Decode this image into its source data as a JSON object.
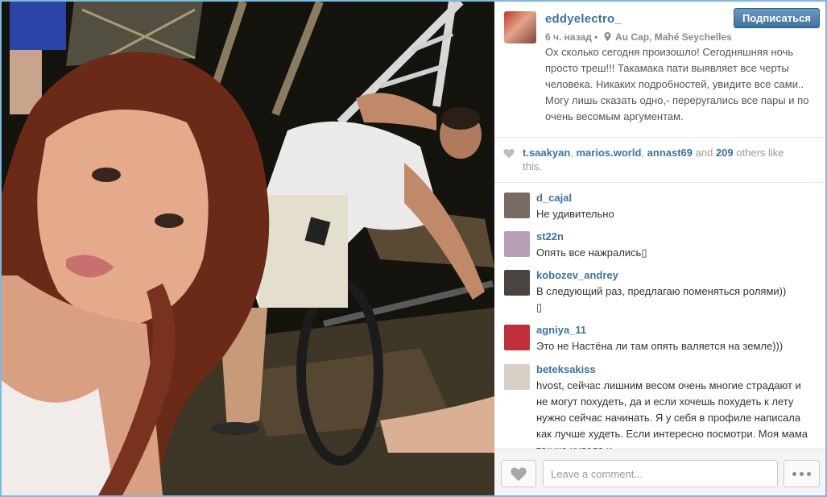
{
  "post": {
    "username": "eddyelectro_",
    "follow_label": "Подписаться",
    "time_ago": "6 ч. назад",
    "separator": "•",
    "location": "Au Cap, Mahé Seychelles",
    "caption": "Ох сколько сегодня произошло! Сегодняшняя ночь просто треш!!! Такамака пати выявляет все черты человека. Никаких подробностей, увидите все сами.. Могу лишь сказать одно,- переругались все пары и по очень весомым аргументам."
  },
  "likes": {
    "users": [
      "t.saakyan",
      "marios.world",
      "annast69"
    ],
    "sep1": ", ",
    "sep2": ", ",
    "and_text": " and ",
    "others_count": "209",
    "others_text": " others like this."
  },
  "comments": [
    {
      "user": "d_cajal",
      "text": "Не удивительно",
      "avatar_color": "#7a6a66"
    },
    {
      "user": "st22n",
      "text": "Опять все нажрались▯",
      "avatar_color": "#b5a0b8"
    },
    {
      "user": "kobozev_andrey",
      "text": "В следующий раз, предлагаю поменяться ролями))\n▯",
      "avatar_color": "#4a4440"
    },
    {
      "user": "agniya_11",
      "text": "Это не Настёна ли там опять валяется на земле)))",
      "avatar_color": "#c0303a"
    },
    {
      "user": "beteksakiss",
      "text": "hvost, сейчас лишним весом очень многие страдают и не могут похудеть, да и если хочешь похудеть к лету нужно сейчас начинать. Я у себя в профиле написала как лучше худеть. Если интересно посмотри. Моя мама так же худела и",
      "avatar_color": "#d8d0c4"
    }
  ],
  "footer": {
    "comment_placeholder": "Leave a comment...",
    "like_icon": "heart-icon",
    "more_icon": "ellipsis-icon"
  },
  "colors": {
    "link": "#3f729b",
    "button": "#3f729b",
    "background": "#7fb8d8"
  }
}
